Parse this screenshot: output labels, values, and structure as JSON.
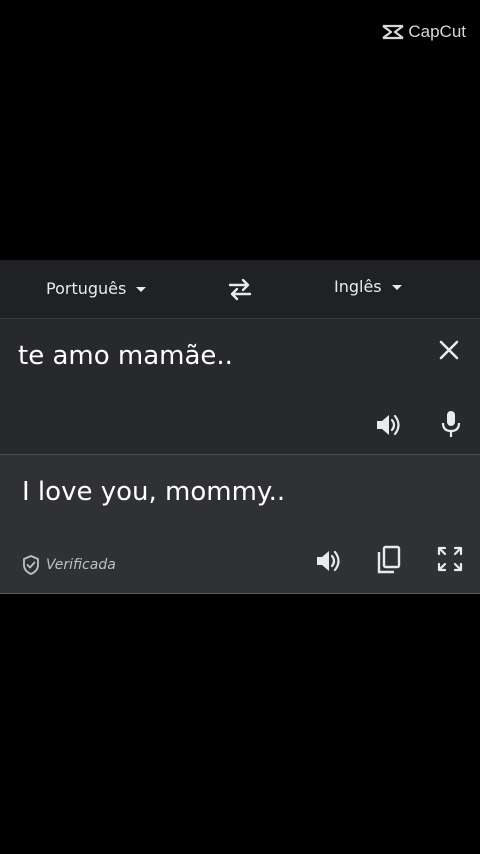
{
  "watermark": {
    "text": "CapCut",
    "icon": "capcut-logo-icon"
  },
  "translator": {
    "source_language": "Português",
    "target_language": "Inglês",
    "swap_icon": "swap-arrows-icon",
    "source_text": "te amo mamãe..",
    "translated_text": "I love you, mommy..",
    "verified_label": "Verificada",
    "icons": {
      "clear": "close-icon",
      "source_speak": "speaker-icon",
      "mic": "microphone-icon",
      "output_speak": "speaker-icon",
      "copy": "copy-icon",
      "expand": "fullscreen-icon",
      "verified": "shield-check-icon"
    }
  },
  "colors": {
    "background": "#000000",
    "panel": "#202124",
    "input_card": "#28292c",
    "output_card": "#303134",
    "text": "#e8eaed"
  }
}
